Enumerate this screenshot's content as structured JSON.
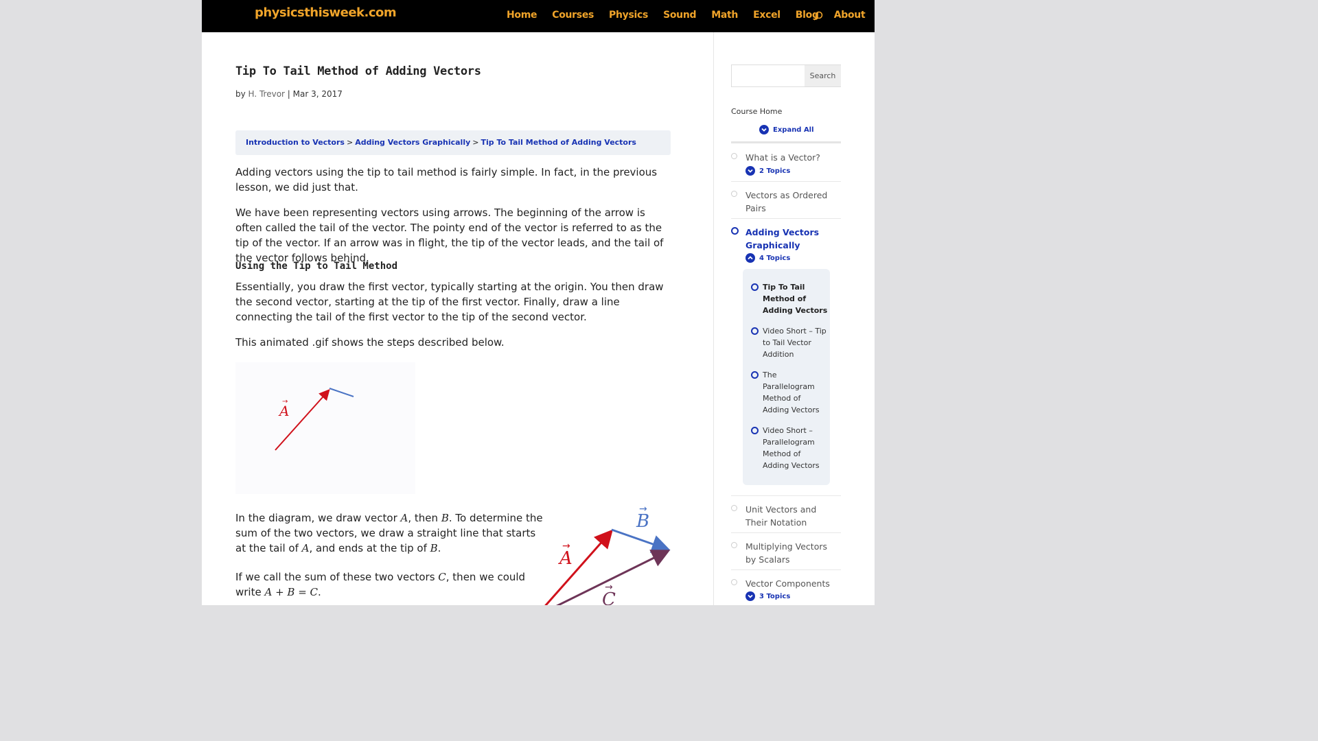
{
  "header": {
    "logo": "physicsthisweek.com",
    "nav": [
      "Home",
      "Courses",
      "Physics",
      "Sound",
      "Math",
      "Excel",
      "Blog",
      "About"
    ]
  },
  "post": {
    "title": "Tip To Tail Method of Adding Vectors",
    "by": "by ",
    "author": "H. Trevor",
    "sep": " | ",
    "date": "Mar 3, 2017"
  },
  "breadcrumb": {
    "items": [
      "Introduction to Vectors",
      "Adding Vectors Graphically",
      "Tip To Tail Method of Adding Vectors"
    ],
    "separator": ">"
  },
  "content": {
    "p1": "Adding vectors using the tip to tail method is fairly simple.  In fact, in the previous lesson, we did just that.",
    "p2": "We have been representing vectors using arrows.  The beginning of the arrow is often called the tail of the vector.  The pointy end of the vector is referred to as the tip of the vector.  If an arrow was in flight, the tip of the vector leads, and the tail of the vector follows behind.",
    "heading": "Using the Tip to Tail Method",
    "p3": "Essentially, you draw the first vector, typically starting at the origin.  You then draw the second vector, starting at the tip of the first vector.  Finally, draw a line connecting the tail of the first vector to the tip of the second vector.",
    "p4": "This animated .gif shows the steps described below.",
    "p5_a": "In the diagram, we draw vector ",
    "p5_b": ", then ",
    "p5_c": ".  To determine the sum of the two vectors, we draw a straight line that starts at the tail of ",
    "p5_d": ", and ends at the tip of ",
    "p5_e": ".",
    "p6_a": "If we call the sum of these two vectors ",
    "p6_b": ", then we could write ",
    "p6_c": "."
  },
  "math": {
    "A": "A",
    "B": "B",
    "C": "C",
    "equation": "A + B = C"
  },
  "sidebar": {
    "search_placeholder": "",
    "search_button": "Search",
    "course_home": "Course Home",
    "expand_all": "Expand All",
    "lessons": [
      {
        "title": "What is a Vector?",
        "topics": "2 Topics"
      },
      {
        "title": "Vectors as Ordered Pairs"
      },
      {
        "title": "Adding Vectors Graphically",
        "topics": "4 Topics"
      },
      {
        "title": "Unit Vectors and Their Notation"
      },
      {
        "title": "Multiplying Vectors by Scalars"
      },
      {
        "title": "Vector Components",
        "topics": "3 Topics"
      }
    ],
    "topics": [
      "Tip To Tail Method of Adding Vectors",
      "Video Short – Tip to Tail Vector Addition",
      "The Parallelogram Method of Adding Vectors",
      "Video Short – Parallelogram Method of Adding Vectors"
    ]
  },
  "colors": {
    "logo": "#f0a42a",
    "link": "#1833b3",
    "vector_a": "#d0111b",
    "vector_b": "#4a73c4",
    "vector_c": "#6e3558"
  }
}
